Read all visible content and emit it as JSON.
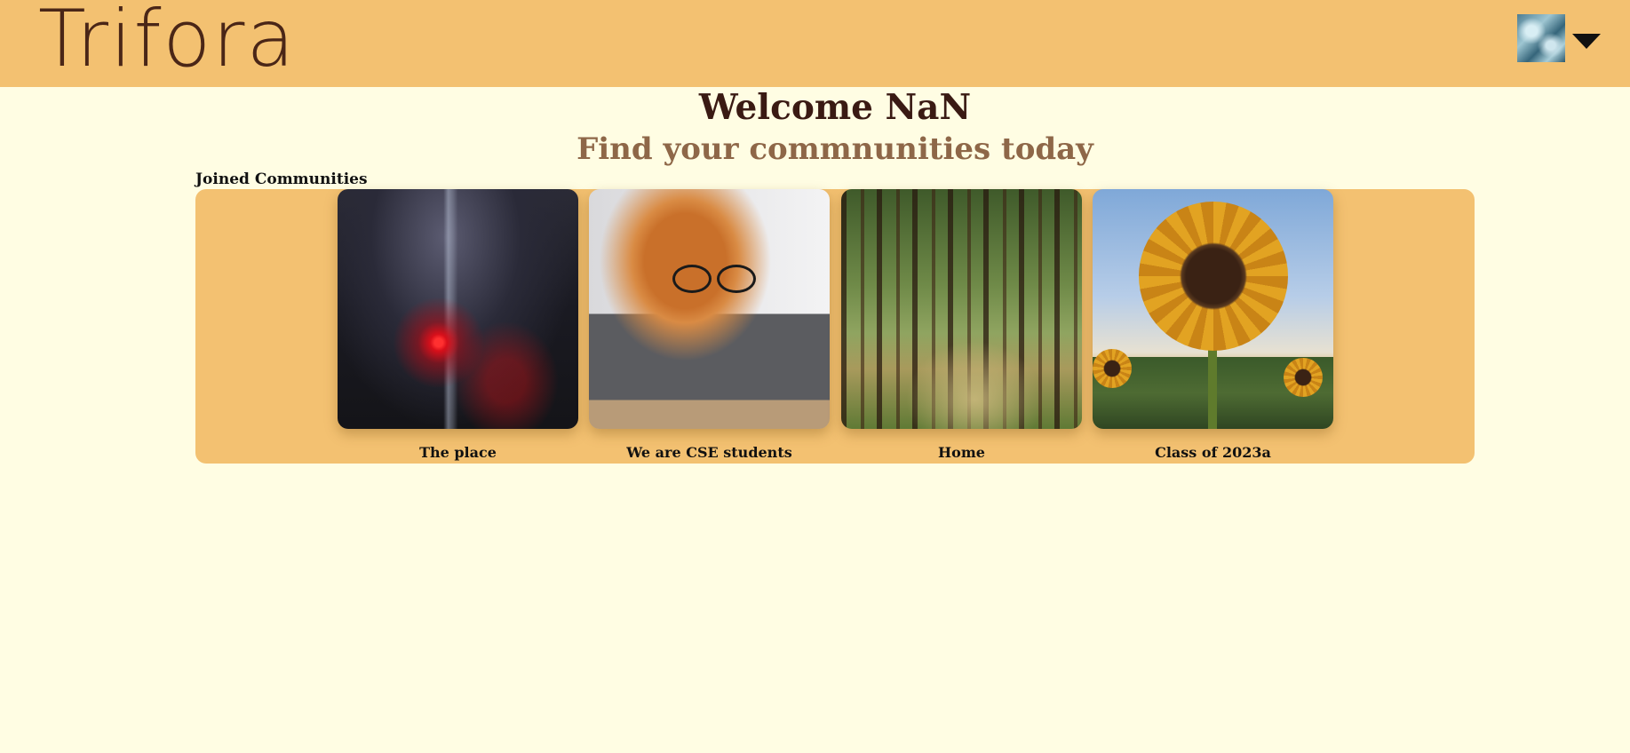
{
  "app": {
    "logo": "Trifora"
  },
  "header": {
    "welcome": "Welcome NaN",
    "tagline": "Find your commnunities today"
  },
  "joined": {
    "section_label": "Joined Communities",
    "communities": [
      {
        "name": "The place"
      },
      {
        "name": "We are CSE students"
      },
      {
        "name": "Home"
      },
      {
        "name": "Class of 2023a"
      }
    ]
  },
  "colors": {
    "topbar": "#f3c171",
    "background": "#fffde3",
    "logo_text": "#4a2617",
    "welcome_text": "#3a1a13",
    "tagline_text": "#8e6748"
  }
}
